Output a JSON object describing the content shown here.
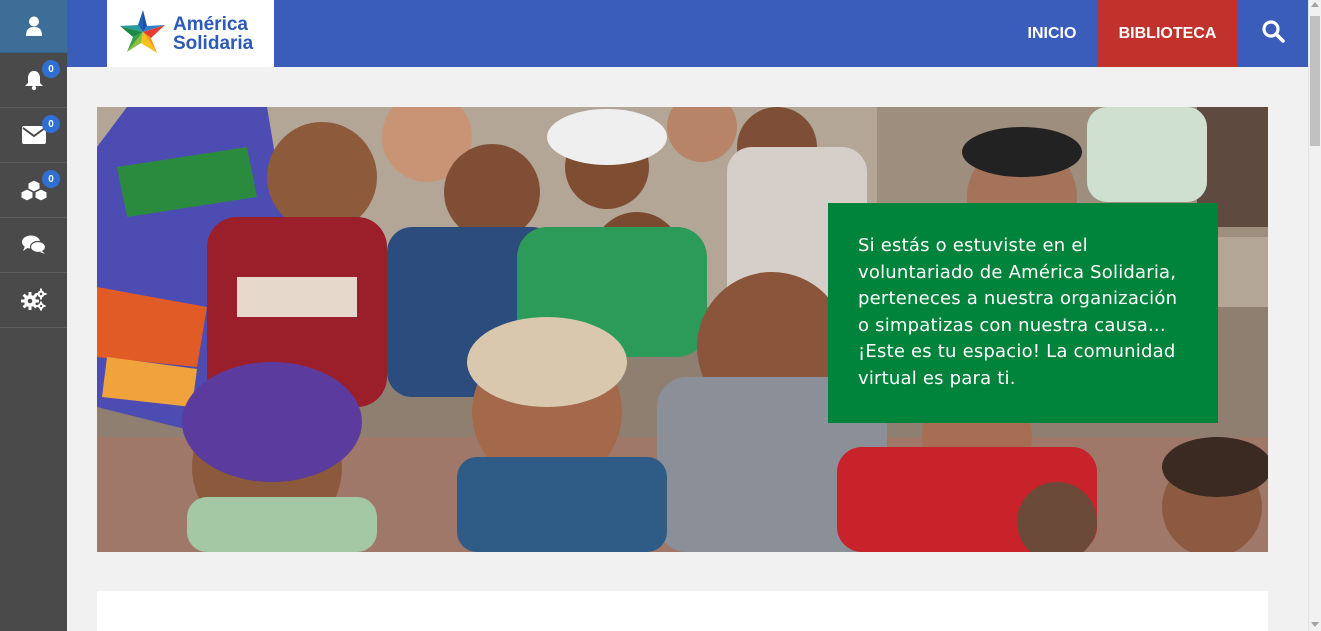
{
  "sidebar": {
    "items": [
      {
        "icon": "user-icon",
        "badge": null
      },
      {
        "icon": "bell-icon",
        "badge": "0"
      },
      {
        "icon": "envelope-icon",
        "badge": "0"
      },
      {
        "icon": "cubes-icon",
        "badge": "0"
      },
      {
        "icon": "comments-icon",
        "badge": null
      },
      {
        "icon": "gears-icon",
        "badge": null
      }
    ]
  },
  "header": {
    "logo_line1": "América",
    "logo_line2": "Solidaria",
    "nav": {
      "inicio": "INICIO",
      "biblioteca": "BIBLIOTECA"
    },
    "search_icon": "search-icon"
  },
  "hero": {
    "message": "Si estás o estuviste en el voluntariado de América Solidaria, perteneces a nuestra organización o simpatizas con nuestra causa... ¡Este es tu espacio! La comunidad virtual es para ti."
  },
  "colors": {
    "sidebar": "#4a4a4a",
    "sidebar_active": "#3c6e97",
    "topbar": "#3a5cbb",
    "active_nav": "#c2322c",
    "hero_card": "#00833b",
    "badge": "#2f6fd1"
  }
}
